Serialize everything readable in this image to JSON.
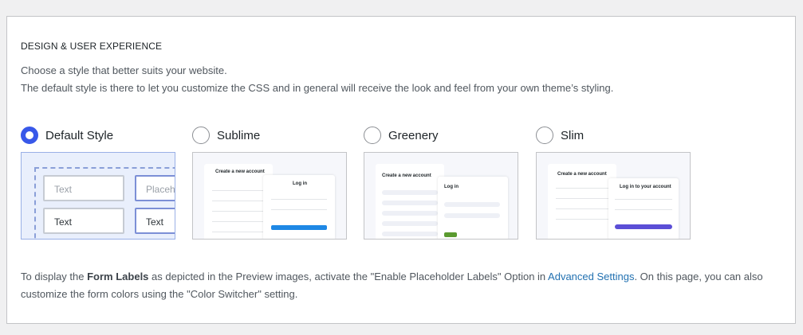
{
  "section": {
    "title": "DESIGN & USER EXPERIENCE",
    "desc_line1": "Choose a style that better suits your website.",
    "desc_line2": "The default style is there to let you customize the CSS and in general will receive the look and feel from your own theme’s styling."
  },
  "options": [
    {
      "label": "Default Style",
      "selected": true,
      "preview": {
        "field1": "Text",
        "field2": "Placeholder",
        "field3": "Text",
        "field4": "Text"
      }
    },
    {
      "label": "Sublime",
      "selected": false,
      "preview": {
        "create": "Create a new account",
        "login": "Log in"
      }
    },
    {
      "label": "Greenery",
      "selected": false,
      "preview": {
        "create": "Create a new account",
        "login": "Log in"
      }
    },
    {
      "label": "Slim",
      "selected": false,
      "preview": {
        "create": "Create a new account",
        "login": "Log in to your account"
      }
    }
  ],
  "footer": {
    "part1": "To display the ",
    "bold": "Form Labels",
    "part2": " as depicted in the Preview images, activate the \"Enable Placeholder Labels\" Option in ",
    "link": "Advanced Settings",
    "part3": ". On this page, you can also customize the form colors using the \"Color Switcher\" setting."
  },
  "colors": {
    "accent": "#3858e9",
    "link": "#2271b1",
    "sublime_button": "#1e88e5",
    "greenery_button": "#5a9a2f",
    "slim_button": "#5b4ed6"
  }
}
